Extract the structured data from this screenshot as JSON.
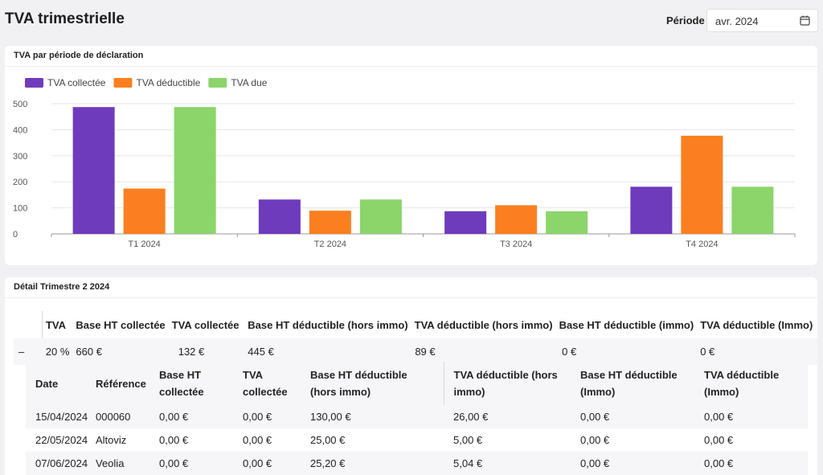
{
  "header": {
    "title": "TVA trimestrielle",
    "period_label": "Période",
    "period_value": "avr. 2024"
  },
  "chart_card": {
    "title": "TVA par période de déclaration"
  },
  "chart_data": {
    "type": "bar",
    "title": "TVA par période de déclaration",
    "categories": [
      "T1 2024",
      "T2 2024",
      "T3 2024",
      "T4 2024"
    ],
    "series": [
      {
        "name": "TVA collectée",
        "color": "#6f3bbd",
        "values": [
          487,
          132,
          87,
          181
        ]
      },
      {
        "name": "TVA déductible",
        "color": "#fb7f20",
        "values": [
          174,
          89,
          110,
          377
        ]
      },
      {
        "name": "TVA due",
        "color": "#8bd56b",
        "values": [
          487,
          132,
          87,
          181
        ]
      }
    ],
    "yticks": [
      0,
      100,
      200,
      300,
      400,
      500
    ],
    "ylim": [
      0,
      500
    ],
    "grid": true,
    "legend_position": "top-left"
  },
  "detail_card": {
    "title": "Détail Trimestre 2 2024",
    "main_headers": [
      "TVA",
      "Base HT collectée",
      "TVA collectée",
      "Base HT déductible (hors immo)",
      "TVA déductible (hors immo)",
      "Base HT déductible (immo)",
      "TVA déductible (Immo)"
    ],
    "main_row": {
      "toggle": "–",
      "tva": "20 %",
      "base_collectee": "660 €",
      "tva_collectee": "132 €",
      "base_deductible_hors_immo": "445 €",
      "tva_deductible_hors_immo": "89 €",
      "base_deductible_immo": "0 €",
      "tva_deductible_immo": "0 €"
    },
    "sub_headers": [
      "Date",
      "Référence",
      "Base HT collectée",
      "TVA collectée",
      "Base HT déductible (hors immo)",
      "TVA déductible (hors immo)",
      "Base HT déductible (Immo)",
      "TVA déductible (Immo)"
    ],
    "sub_rows": [
      [
        "15/04/2024",
        "000060",
        "0,00 €",
        "0,00 €",
        "130,00 €",
        "26,00 €",
        "0,00 €",
        "0,00 €"
      ],
      [
        "22/05/2024",
        "Altoviz",
        "0,00 €",
        "0,00 €",
        "25,00 €",
        "5,00 €",
        "0,00 €",
        "0,00 €"
      ],
      [
        "07/06/2024",
        "Veolia",
        "0,00 €",
        "0,00 €",
        "25,20 €",
        "5,04 €",
        "0,00 €",
        "0,00 €"
      ]
    ]
  }
}
